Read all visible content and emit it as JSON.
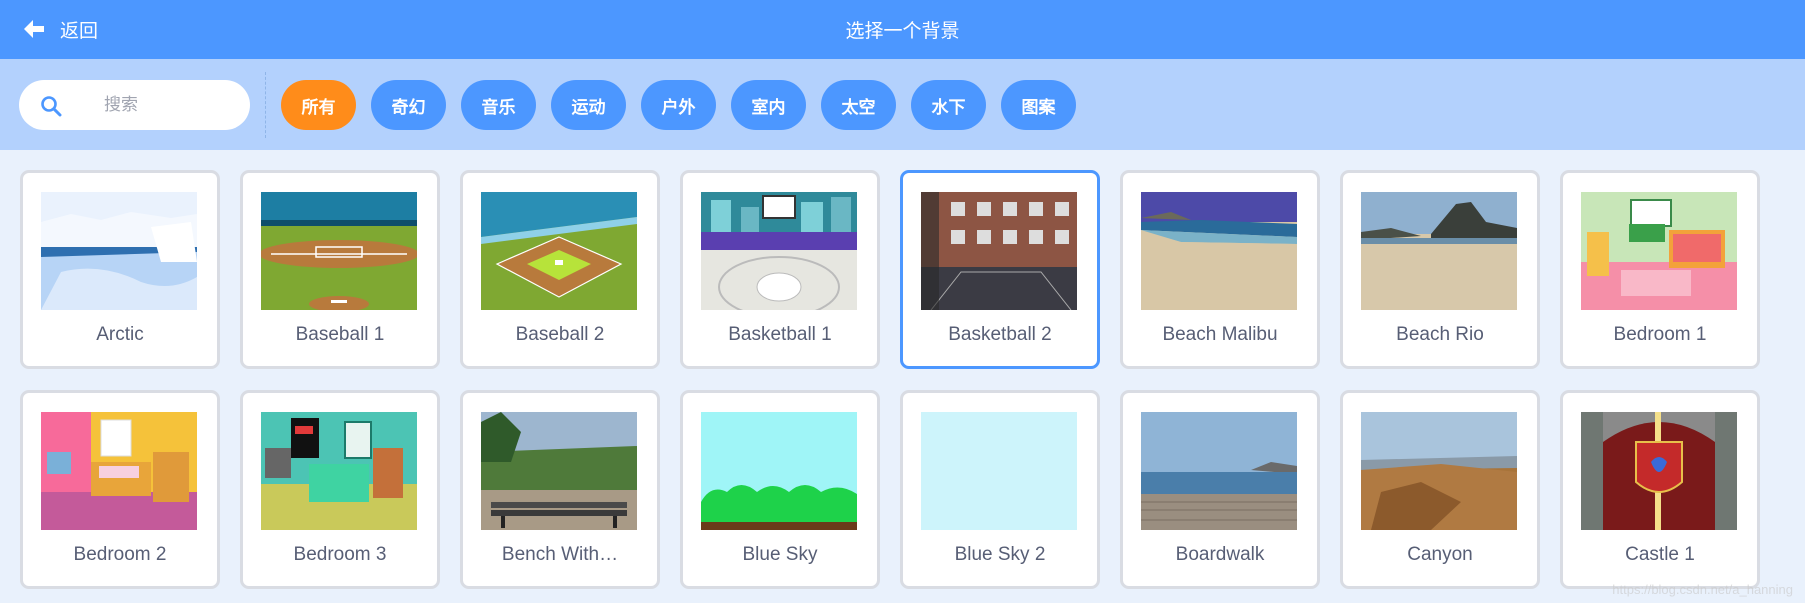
{
  "header": {
    "back_label": "返回",
    "title": "选择一个背景"
  },
  "search": {
    "placeholder": "搜索"
  },
  "tags": [
    "所有",
    "奇幻",
    "音乐",
    "运动",
    "户外",
    "室内",
    "太空",
    "水下",
    "图案"
  ],
  "active_tag": "所有",
  "backdrops": [
    {
      "name": "Arctic",
      "thumb": "arctic"
    },
    {
      "name": "Baseball 1",
      "thumb": "baseball1"
    },
    {
      "name": "Baseball 2",
      "thumb": "baseball2"
    },
    {
      "name": "Basketball 1",
      "thumb": "basketball1"
    },
    {
      "name": "Basketball 2",
      "thumb": "basketball2"
    },
    {
      "name": "Beach Malibu",
      "thumb": "beachmalibu"
    },
    {
      "name": "Beach Rio",
      "thumb": "beachrio"
    },
    {
      "name": "Bedroom 1",
      "thumb": "bedroom1"
    },
    {
      "name": "Bedroom 2",
      "thumb": "bedroom2"
    },
    {
      "name": "Bedroom 3",
      "thumb": "bedroom3"
    },
    {
      "name": "Bench With…",
      "thumb": "bench"
    },
    {
      "name": "Blue Sky",
      "thumb": "bluesky"
    },
    {
      "name": "Blue Sky 2",
      "thumb": "bluesky2"
    },
    {
      "name": "Boardwalk",
      "thumb": "boardwalk"
    },
    {
      "name": "Canyon",
      "thumb": "canyon"
    },
    {
      "name": "Castle 1",
      "thumb": "castle1"
    }
  ],
  "selected_backdrop": "Basketball 2",
  "watermark": "https://blog.csdn.net/a_hanning",
  "colors": {
    "header": "#4c97ff",
    "filterbar": "#b3d1fd",
    "active_tag": "#ff8c1a",
    "tag": "#4c97ff",
    "selected_border": "#4c97ff"
  },
  "icons": {
    "back": "arrow-left-icon",
    "search": "magnifier-icon"
  }
}
